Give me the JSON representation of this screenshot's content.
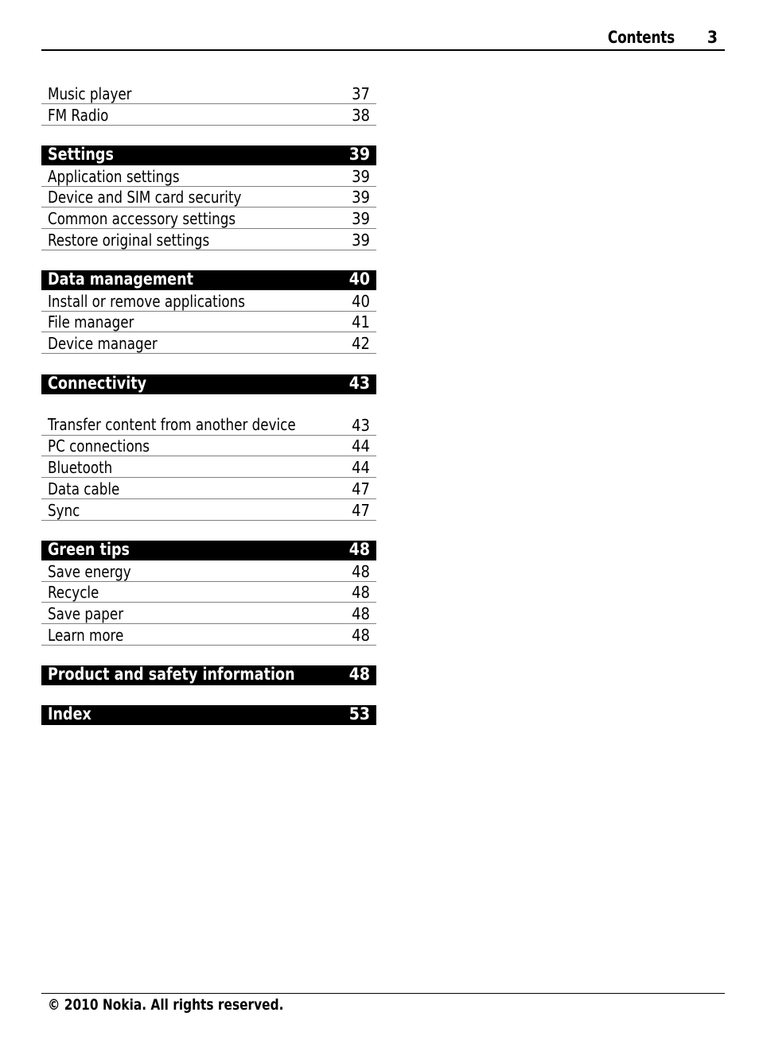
{
  "header": {
    "title": "Contents",
    "page_number": "3"
  },
  "toc": {
    "continued": [
      {
        "label": "Music player",
        "page": "37"
      },
      {
        "label": "FM Radio",
        "page": "38"
      }
    ],
    "sections": [
      {
        "title": "Settings",
        "page": "39",
        "items": [
          {
            "label": "Application settings",
            "page": "39"
          },
          {
            "label": "Device and SIM card security",
            "page": "39"
          },
          {
            "label": "Common accessory settings",
            "page": "39"
          },
          {
            "label": "Restore original settings",
            "page": "39"
          }
        ]
      },
      {
        "title": "Data management",
        "page": "40",
        "items": [
          {
            "label": "Install or remove applications",
            "page": "40"
          },
          {
            "label": "File manager",
            "page": "41"
          },
          {
            "label": "Device manager",
            "page": "42"
          }
        ]
      },
      {
        "title": "Connectivity",
        "page": "43",
        "items": [
          {
            "label": "Transfer content from another device",
            "page": "43"
          },
          {
            "label": "PC connections",
            "page": "44"
          },
          {
            "label": "Bluetooth",
            "page": "44"
          },
          {
            "label": "Data cable",
            "page": "47"
          },
          {
            "label": "Sync",
            "page": "47"
          }
        ]
      },
      {
        "title": "Green tips",
        "page": "48",
        "items": [
          {
            "label": "Save energy",
            "page": "48"
          },
          {
            "label": "Recycle",
            "page": "48"
          },
          {
            "label": "Save paper",
            "page": "48"
          },
          {
            "label": "Learn more",
            "page": "48"
          }
        ]
      },
      {
        "title": "Product and safety information",
        "page": "48",
        "items": []
      },
      {
        "title": "Index",
        "page": "53",
        "items": []
      }
    ]
  },
  "footer": {
    "copyright": "© 2010 Nokia. All rights reserved."
  }
}
